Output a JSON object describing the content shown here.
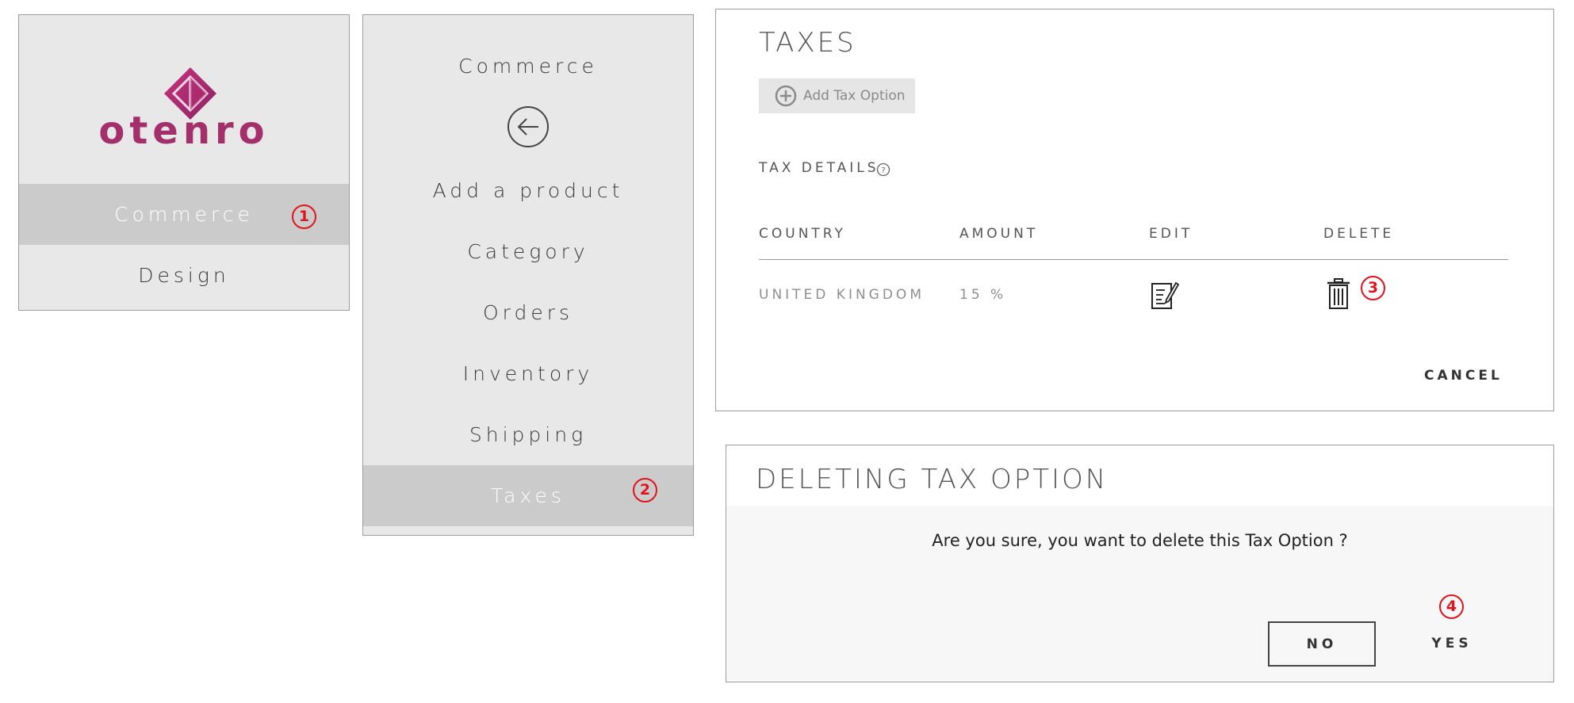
{
  "brand": {
    "name": "otenro",
    "color": "#a32f6b"
  },
  "menu_main": {
    "items": [
      {
        "label": "Commerce",
        "active": true
      },
      {
        "label": "Design",
        "active": false
      }
    ]
  },
  "menu_commerce": {
    "title": "Commerce",
    "items": [
      {
        "label": "Add a product"
      },
      {
        "label": "Category"
      },
      {
        "label": "Orders"
      },
      {
        "label": "Inventory"
      },
      {
        "label": "Shipping"
      },
      {
        "label": "Taxes",
        "active": true
      }
    ]
  },
  "taxes": {
    "title": "TAXES",
    "add_button": "Add Tax Option",
    "section_label": "TAX DETAILS",
    "columns": [
      "COUNTRY",
      "AMOUNT",
      "EDIT",
      "DELETE"
    ],
    "rows": [
      {
        "country": "UNITED KINGDOM",
        "amount": "15 %"
      }
    ],
    "cancel": "CANCEL"
  },
  "dialog": {
    "title": "DELETING TAX OPTION",
    "message": "Are you sure, you want to delete this Tax Option ?",
    "no": "NO",
    "yes": "YES"
  },
  "markers": [
    "1",
    "2",
    "3",
    "4"
  ],
  "colors": {
    "marker": "#e0141e",
    "active_row": "#cbcbcb",
    "panel_bg": "#e8e8e8"
  }
}
